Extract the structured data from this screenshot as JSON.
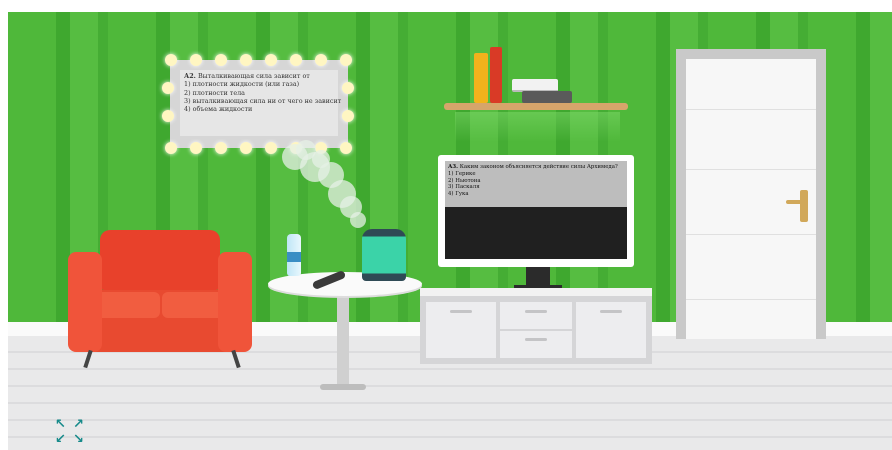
{
  "mirror_question": {
    "number": "А2.",
    "title": "Выталкивающая сила зависит от",
    "options": [
      "1) плотности жидкости (или газа)",
      "2) плотности тела",
      "3) выталкивающая сила ни от чего не зависит",
      "4) объема жидкости"
    ]
  },
  "tv_question": {
    "number": "А3.",
    "title": "Каким законом объясняется действие силы Архимеда?",
    "options": [
      "1) Герике",
      "2) Ньютона",
      "3) Паскаля",
      "4) Гука"
    ]
  },
  "fullscreen_button": {
    "icon": "expand-arrows-icon",
    "color": "#168a8a"
  },
  "colors": {
    "wall": "#4fb83a",
    "armchair": "#e8412b",
    "kettle_water": "#3bd3a8",
    "shelf": "#d6a56b"
  }
}
